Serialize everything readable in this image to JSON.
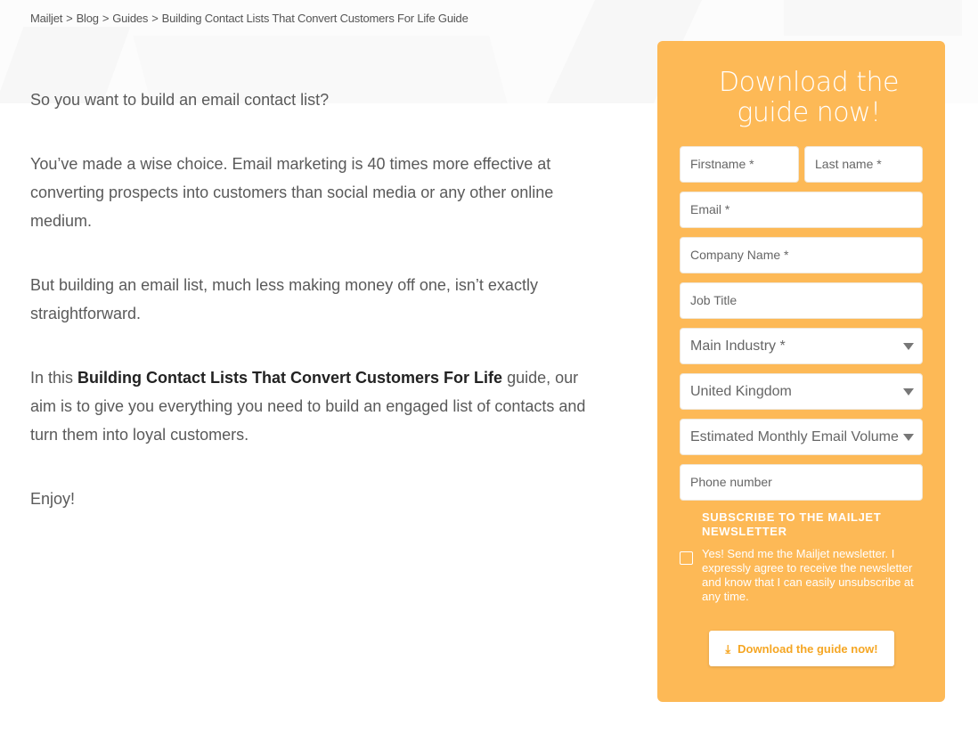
{
  "breadcrumb": {
    "items": [
      "Mailjet",
      "Blog",
      "Guides",
      "Building Contact Lists That Convert Customers For Life Guide"
    ],
    "separator": ">"
  },
  "article": {
    "p1": "So you want to build an email contact list?",
    "p2": "You’ve made a wise choice. Email marketing is 40 times more effective at converting prospects into customers than social media or any other online medium.",
    "p3": "But building an email list, much less making money off one, isn’t exactly straightforward.",
    "p4_prefix": "In this ",
    "p4_bold": "Building Contact Lists That Convert Customers For Life",
    "p4_suffix": " guide, our aim is to give you everything you need to build an engaged list of contacts and turn them into loyal customers.",
    "p5": "Enjoy!"
  },
  "form": {
    "title": "Download the guide now!",
    "accent_color": "#fdb956",
    "fields": {
      "firstname": {
        "placeholder": "Firstname *",
        "value": ""
      },
      "lastname": {
        "placeholder": "Last name *",
        "value": ""
      },
      "email": {
        "placeholder": "Email *",
        "value": ""
      },
      "company": {
        "placeholder": "Company Name *",
        "value": ""
      },
      "job_title": {
        "placeholder": "Job Title",
        "value": ""
      },
      "industry": {
        "selected": "Main Industry *"
      },
      "country": {
        "selected": "United Kingdom"
      },
      "volume": {
        "selected": "Estimated Monthly Email Volume"
      },
      "phone": {
        "placeholder": "Phone number",
        "value": ""
      }
    },
    "newsletter": {
      "heading": "SUBSCRIBE TO THE MAILJET NEWSLETTER",
      "consent": "Yes! Send me the Mailjet newsletter. I expressly agree to receive the newsletter and know that I can easily unsubscribe at any time.",
      "checked": false
    },
    "submit": {
      "label": "Download the guide now!",
      "icon": "download-icon"
    }
  }
}
